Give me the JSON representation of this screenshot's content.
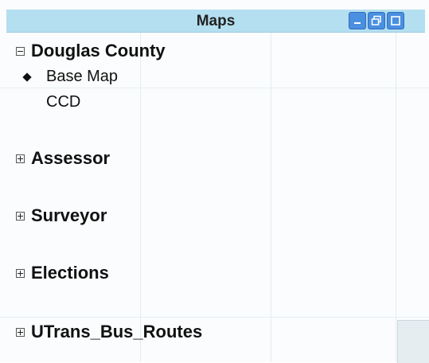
{
  "window": {
    "title": "Maps",
    "buttons": [
      "minimize",
      "restore",
      "maximize"
    ]
  },
  "tree": {
    "douglas": {
      "label": "Douglas County",
      "expanded": true,
      "children": [
        "Base Map",
        "CCD"
      ],
      "selected": "Base Map"
    },
    "assessor": {
      "label": "Assessor",
      "expanded": false
    },
    "surveyor": {
      "label": "Surveyor",
      "expanded": false
    },
    "elections": {
      "label": "Elections",
      "expanded": false
    },
    "utrans": {
      "label": "UTrans_Bus_Routes",
      "expanded": false
    }
  },
  "colors": {
    "titlebar": "#b4dff0",
    "button": "#4a8fe0"
  }
}
